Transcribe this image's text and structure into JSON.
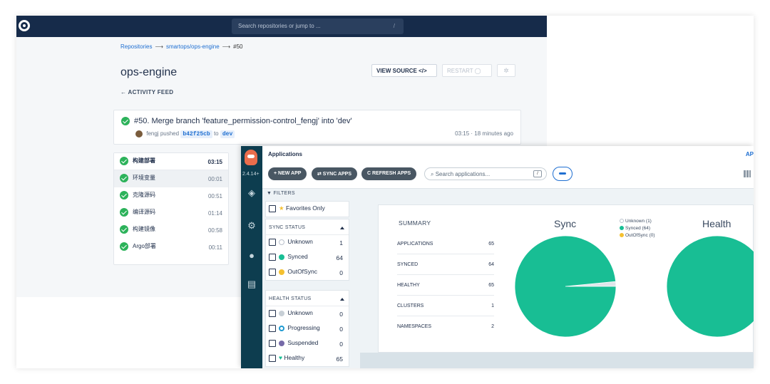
{
  "ci": {
    "search_placeholder": "Search repositories or jump to ...",
    "search_shortcut": "/",
    "breadcrumb": {
      "repositories": "Repositories",
      "repo": "smartops/ops-engine",
      "build": "#50",
      "arrow": "⟶"
    },
    "title": "ops-engine",
    "activity_feed": "← ACTIVITY FEED",
    "view_source_label": "VIEW SOURCE </>",
    "restart_label": "RESTART ◯",
    "commit": {
      "title": "#50. Merge branch 'feature_permission-control_fengj' into 'dev'",
      "author": "fengj",
      "pushed": "pushed",
      "sha": "b42f25cb",
      "to": "to",
      "branch": "dev",
      "time": "03:15 · 18 minutes ago"
    },
    "steps": [
      {
        "name": "构建部署",
        "duration": "03:15"
      },
      {
        "name": "环境变量",
        "duration": "00:01"
      },
      {
        "name": "克隆源码",
        "duration": "00:51"
      },
      {
        "name": "编译源码",
        "duration": "01:14"
      },
      {
        "name": "构建镜像",
        "duration": "00:58"
      },
      {
        "name": "Argo部署",
        "duration": "00:11"
      }
    ],
    "colors": {
      "topbar": "#162b4a",
      "link": "#1f6fd1",
      "success": "#2cb25a"
    }
  },
  "argo": {
    "version": "2.4.14+",
    "header_title": "Applications",
    "header_right": "AP",
    "toolbar": {
      "new_app": "+ NEW APP",
      "sync_apps": "⇄ SYNC APPS",
      "refresh_apps": "C REFRESH APPS",
      "search_placeholder": "Search applications...",
      "search_shortcut": "/"
    },
    "filters": {
      "title": "FILTERS",
      "favorites": "Favorites Only",
      "sync_status": {
        "title": "SYNC STATUS",
        "items": [
          {
            "label": "Unknown",
            "count": "1"
          },
          {
            "label": "Synced",
            "count": "64"
          },
          {
            "label": "OutOfSync",
            "count": "0"
          }
        ]
      },
      "health_status": {
        "title": "HEALTH STATUS",
        "items": [
          {
            "label": "Unknown",
            "count": "0"
          },
          {
            "label": "Progressing",
            "count": "0"
          },
          {
            "label": "Suspended",
            "count": "0"
          },
          {
            "label": "Healthy",
            "count": "65"
          }
        ]
      }
    },
    "summary": {
      "title": "SUMMARY",
      "rows": [
        {
          "label": "APPLICATIONS",
          "value": "65"
        },
        {
          "label": "SYNCED",
          "value": "64"
        },
        {
          "label": "HEALTHY",
          "value": "65"
        },
        {
          "label": "CLUSTERS",
          "value": "1"
        },
        {
          "label": "NAMESPACES",
          "value": "2"
        }
      ]
    },
    "sync_chart_title": "Sync",
    "health_chart_title": "Health",
    "legend": [
      {
        "label": "Unknown (1)",
        "color": "#dfe5ea"
      },
      {
        "label": "Synced (64)",
        "color": "#18be94"
      },
      {
        "label": "OutOfSync (0)",
        "color": "#f4c030"
      }
    ],
    "chart_data": [
      {
        "type": "pie",
        "title": "Sync",
        "categories": [
          "Unknown",
          "Synced",
          "OutOfSync"
        ],
        "values": [
          1,
          64,
          0
        ],
        "colors": [
          "#dfe5ea",
          "#18be94",
          "#f4c030"
        ]
      },
      {
        "type": "pie",
        "title": "Health",
        "categories": [
          "Healthy"
        ],
        "values": [
          65
        ],
        "colors": [
          "#18be94"
        ]
      }
    ],
    "colors": {
      "sidebar": "#0d3d4f",
      "button": "#495763",
      "accent": "#1f6fd1",
      "synced": "#18be94",
      "outofsync": "#f4c030"
    }
  }
}
